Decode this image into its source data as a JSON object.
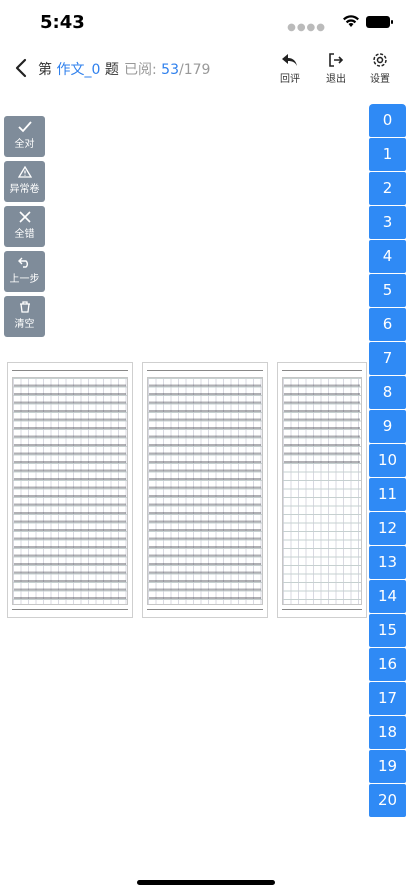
{
  "status_bar": {
    "time": "5:43"
  },
  "header": {
    "title_prefix": "第",
    "title_name": "作文_0",
    "title_suffix": "题",
    "read_label": "已阅:",
    "read_count": "53",
    "read_total": "/179"
  },
  "actions": {
    "review": "回评",
    "exit": "退出",
    "settings": "设置"
  },
  "side_tools": [
    {
      "label": "全对",
      "icon": "check-icon"
    },
    {
      "label": "异常卷",
      "icon": "warning-icon"
    },
    {
      "label": "全错",
      "icon": "x-icon"
    },
    {
      "label": "上一步",
      "icon": "undo-icon"
    },
    {
      "label": "清空",
      "icon": "trash-icon"
    }
  ],
  "score_buttons": [
    "0",
    "1",
    "2",
    "3",
    "4",
    "5",
    "6",
    "7",
    "8",
    "9",
    "10",
    "11",
    "12",
    "13",
    "14",
    "15",
    "16",
    "17",
    "18",
    "19",
    "20"
  ],
  "colors": {
    "accent": "#2f8af5",
    "tool_bg": "#7f8c9a"
  }
}
